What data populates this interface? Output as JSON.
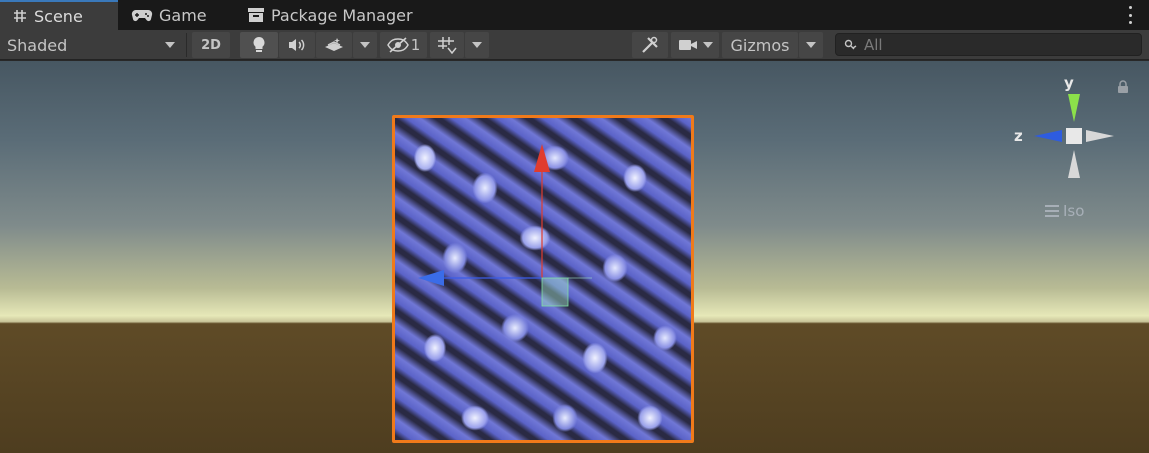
{
  "tabs": [
    {
      "label": "Scene",
      "icon": "grid-hash-icon",
      "active": true
    },
    {
      "label": "Game",
      "icon": "gamepad-icon",
      "active": false
    },
    {
      "label": "Package Manager",
      "icon": "package-icon",
      "active": false
    }
  ],
  "toolbar": {
    "draw_mode": "Shaded",
    "mode_2d": "2D",
    "hidden_count": "1",
    "gizmos_label": "Gizmos",
    "search_placeholder": "All"
  },
  "orientation_gizmo": {
    "y_label": "y",
    "z_label": "z",
    "projection_label": "Iso"
  },
  "colors": {
    "selection_outline": "#f07a1a",
    "axis_x": "#e03c2e",
    "axis_y": "#8ce04a",
    "axis_z": "#2e5ce0",
    "active_tab_accent": "#3a79bb"
  }
}
